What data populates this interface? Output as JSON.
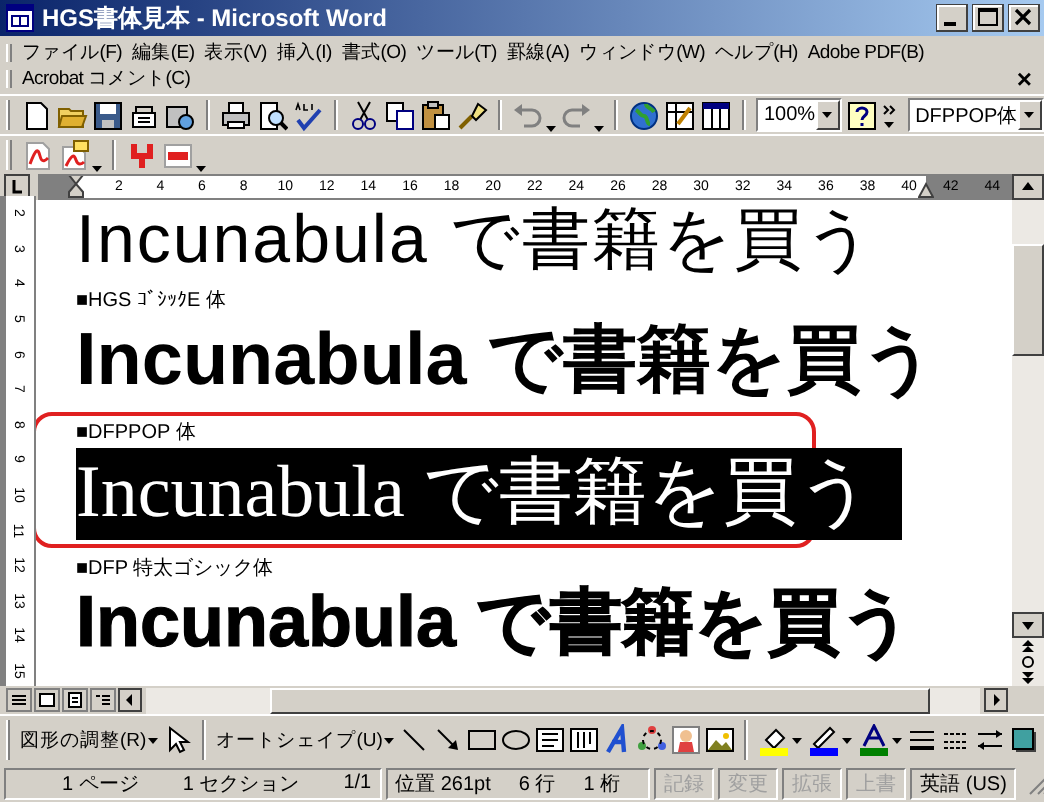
{
  "window": {
    "title": "HGS書体見本 - Microsoft Word"
  },
  "menu_bar": {
    "items": [
      "ファイル(F)",
      "編集(E)",
      "表示(V)",
      "挿入(I)",
      "書式(O)",
      "ツール(T)",
      "罫線(A)",
      "ウィンドウ(W)",
      "ヘルプ(H)",
      "Adobe PDF(B)"
    ]
  },
  "acrobat_bar": {
    "label": "Acrobat コメント(C)",
    "close": "×"
  },
  "toolbar": {
    "zoom": "100%",
    "font": "DFPPOP体"
  },
  "ruler": {
    "labels": [
      "2",
      "4",
      "6",
      "8",
      "10",
      "12",
      "14",
      "16",
      "18",
      "20",
      "22",
      "24",
      "26",
      "28",
      "30",
      "32",
      "34",
      "36",
      "38",
      "40",
      "42",
      "44"
    ]
  },
  "vertical_ruler": {
    "labels": [
      "2",
      "3",
      "4",
      "5",
      "6",
      "7",
      "8",
      "9",
      "10",
      "11",
      "12",
      "13",
      "14",
      "15"
    ]
  },
  "document": {
    "sections": [
      {
        "sample": "Incunabula で書籍を買う",
        "kind": "light",
        "circled": false,
        "highlighted": false
      },
      {
        "label": "■HGS ｺﾞｼｯｸE 体",
        "sample": "Incunabula で書籍を買う",
        "kind": "gothic",
        "circled": false,
        "highlighted": false
      },
      {
        "label": "■DFPPOP 体",
        "sample": "Incunabula で書籍を買う",
        "kind": "pop",
        "circled": true,
        "highlighted": true
      },
      {
        "label": "■DFP 特太ゴシック体",
        "sample": "Incunabula で書籍を買う",
        "kind": "heavy",
        "circled": false,
        "highlighted": false
      }
    ]
  },
  "drawing_toolbar": {
    "adjust": "図形の調整(R)",
    "autoshape": "オートシェイプ(U)"
  },
  "status_bar": {
    "panes": [
      {
        "texts": [
          "1 ページ",
          "1 セクション",
          "1/1"
        ],
        "enabled": true
      },
      {
        "texts": [
          "位置 261pt",
          "6 行",
          "1 桁"
        ],
        "enabled": true
      },
      {
        "texts": [
          "記録"
        ],
        "enabled": false
      },
      {
        "texts": [
          "変更"
        ],
        "enabled": false
      },
      {
        "texts": [
          "拡張"
        ],
        "enabled": false
      },
      {
        "texts": [
          "上書"
        ],
        "enabled": false
      },
      {
        "texts": [
          "英語 (US)"
        ],
        "enabled": true
      }
    ]
  }
}
